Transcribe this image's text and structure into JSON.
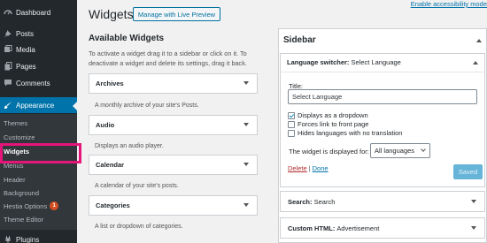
{
  "admin_menu": {
    "items": [
      {
        "label": "Dashboard",
        "icon": "dashboard-icon"
      },
      {
        "label": "Posts",
        "icon": "pin-icon"
      },
      {
        "label": "Media",
        "icon": "media-icon"
      },
      {
        "label": "Pages",
        "icon": "pages-icon"
      },
      {
        "label": "Comments",
        "icon": "comments-icon"
      },
      {
        "label": "Appearance",
        "icon": "brush-icon"
      },
      {
        "label": "Plugins",
        "icon": "plugin-icon"
      }
    ],
    "submenu": [
      {
        "label": "Themes"
      },
      {
        "label": "Customize"
      },
      {
        "label": "Widgets"
      },
      {
        "label": "Menus"
      },
      {
        "label": "Header"
      },
      {
        "label": "Background"
      },
      {
        "label": "Hestia Options",
        "badge": "1"
      },
      {
        "label": "Theme Editor"
      }
    ],
    "accent_color": "#0073aa",
    "highlight_color": "#e6157a"
  },
  "header": {
    "title": "Widgets",
    "preview_button": "Manage with Live Preview",
    "accessibility_link": "Enable accessibility mode"
  },
  "available": {
    "title": "Available Widgets",
    "description": "To activate a widget drag it to a sidebar or click on it. To deactivate a widget and delete its settings, drag it back.",
    "widgets": [
      {
        "name": "Archives",
        "desc": "A monthly archive of your site's Posts."
      },
      {
        "name": "Audio",
        "desc": "Displays an audio player."
      },
      {
        "name": "Calendar",
        "desc": "A calendar of your site's posts."
      },
      {
        "name": "Categories",
        "desc": "A list or dropdown of categories."
      }
    ]
  },
  "sidebar": {
    "title": "Sidebar",
    "language_widget": {
      "header_prefix": "Language switcher:",
      "header_title": "Select Language",
      "title_label": "Title:",
      "title_value": "Select Language",
      "options": [
        {
          "label": "Displays as a dropdown",
          "checked": true
        },
        {
          "label": "Forces link to front page",
          "checked": false
        },
        {
          "label": "Hides languages with no translation",
          "checked": false
        }
      ],
      "display_label": "The widget is displayed for:",
      "display_value": "All languages",
      "delete_label": "Delete",
      "separator": "|",
      "done_label": "Done",
      "saved_label": "Saved"
    },
    "other_widgets": [
      {
        "prefix": "Search:",
        "title": "Search"
      },
      {
        "prefix": "Custom HTML:",
        "title": "Advertisement"
      }
    ]
  }
}
